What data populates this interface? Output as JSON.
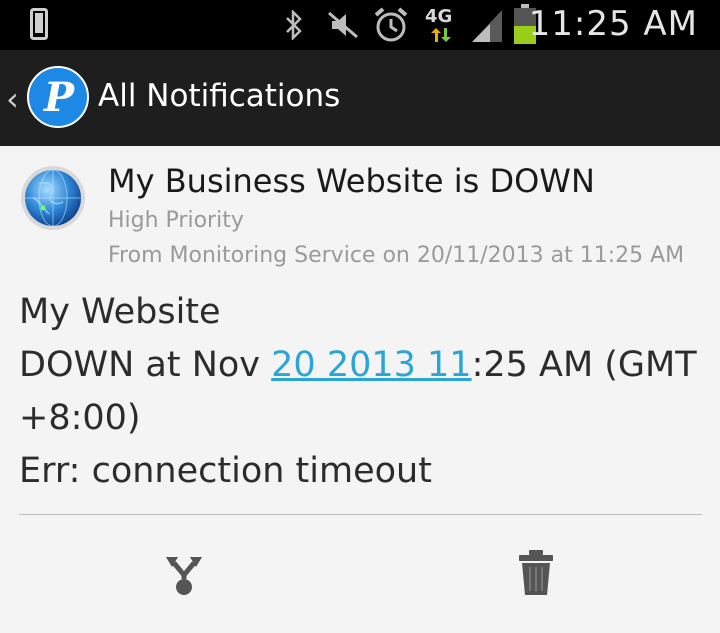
{
  "status_bar": {
    "time": "11:25 AM",
    "network": "4G",
    "icons": [
      "phone-icon",
      "bluetooth-icon",
      "mute-icon",
      "alarm-icon",
      "4g-icon",
      "signal-icon",
      "battery-icon"
    ]
  },
  "action_bar": {
    "title": "All Notifications",
    "logo_letter": "P",
    "accent": "#1e88e5"
  },
  "notification": {
    "title": "My Business Website is DOWN",
    "priority": "High Priority",
    "from": "From Monitoring Service on 20/11/2013 at 11:25 AM",
    "body": {
      "line1": "My Website",
      "line2_prefix": "DOWN at Nov ",
      "line2_link": "20 2013 11",
      "line2_suffix": ":25 AM (GMT",
      "line3": "+8:00)",
      "line4": "Err: connection timeout"
    },
    "link_color": "#2aa6d6"
  },
  "actions": {
    "share_icon": "share-icon",
    "delete_icon": "trash-icon"
  }
}
